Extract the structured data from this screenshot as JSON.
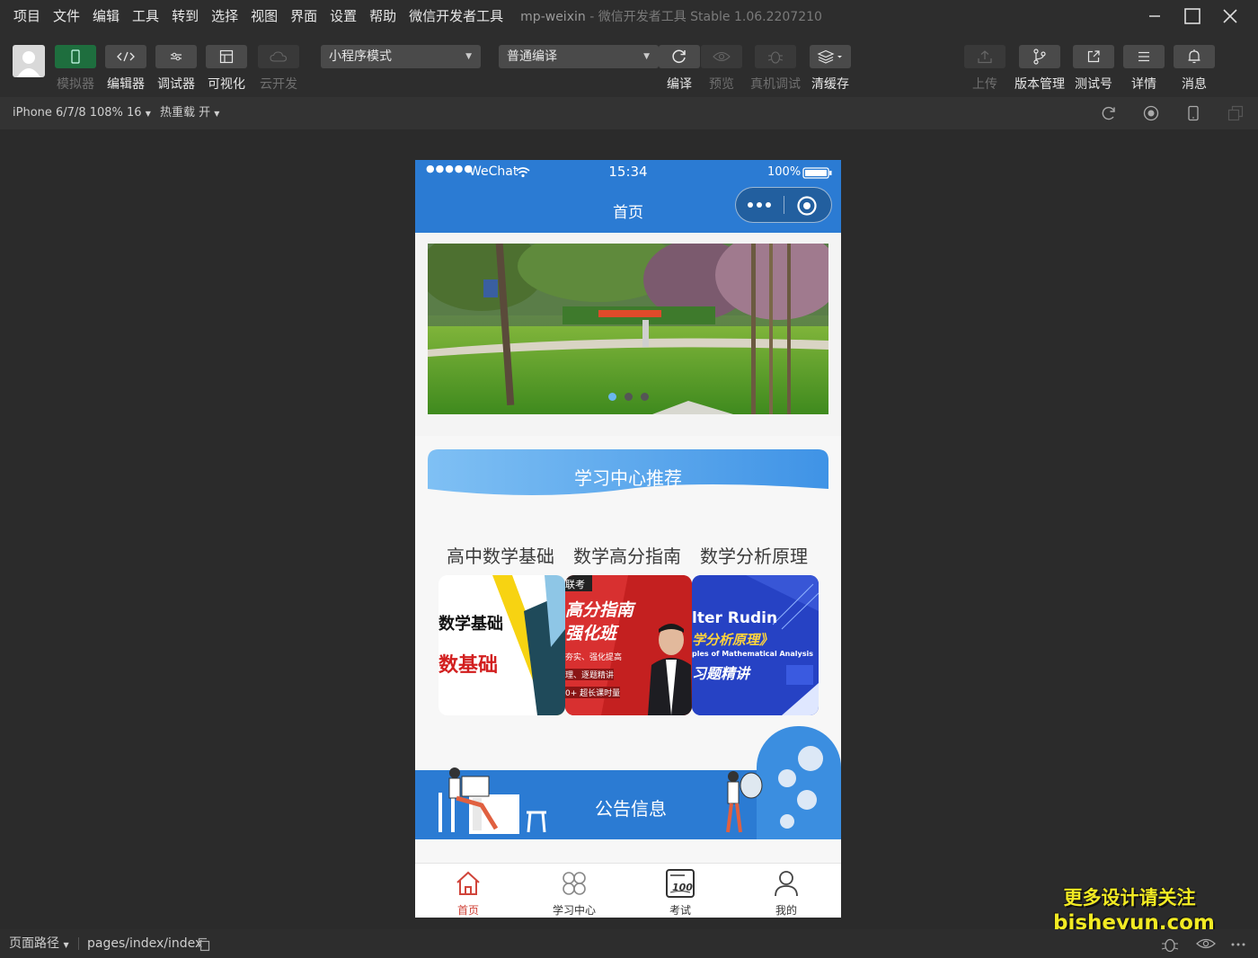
{
  "menubar": {
    "items": [
      "项目",
      "文件",
      "编辑",
      "工具",
      "转到",
      "选择",
      "视图",
      "界面",
      "设置",
      "帮助",
      "微信开发者工具"
    ],
    "project": "mp-weixin",
    "sep": "-",
    "app": "微信开发者工具 Stable 1.06.2207210"
  },
  "toolbar": {
    "simulator": "模拟器",
    "editor": "编辑器",
    "debugger": "调试器",
    "visual": "可视化",
    "cloud": "云开发",
    "mode": "小程序模式",
    "compile_mode": "普通编译",
    "compile": "编译",
    "preview": "预览",
    "remote_debug": "真机调试",
    "clear_cache": "清缓存",
    "upload": "上传",
    "version": "版本管理",
    "test_account": "测试号",
    "details": "详情",
    "messages": "消息"
  },
  "subbar": {
    "device": "iPhone 6/7/8 108% 16",
    "hot_reload": "热重载 开"
  },
  "phone": {
    "status": {
      "carrier": "WeChat",
      "time": "15:34",
      "battery": "100%"
    },
    "nav_title": "首页",
    "section_title": "学习中心推荐",
    "courses": [
      {
        "title": "高中数学基础",
        "cover_text": [
          "数学基础",
          "数基础"
        ]
      },
      {
        "title": "数学高分指南",
        "cover_text": [
          "联考",
          "高分指南",
          "强化班",
          "夯实、强化提高",
          "理、逐题精讲",
          "0+ 超长课时量"
        ]
      },
      {
        "title": "数学分析原理",
        "cover_text": [
          "lter Rudin",
          "学分析原理》",
          "ples of Mathematical Analysis",
          "习题精讲"
        ]
      }
    ],
    "notice_title": "公告信息",
    "tabs": [
      {
        "label": "首页",
        "icon": "home-icon",
        "active": true
      },
      {
        "label": "学习中心",
        "icon": "grid-icon",
        "active": false
      },
      {
        "label": "考试",
        "icon": "exam-icon",
        "active": false
      },
      {
        "label": "我的",
        "icon": "user-icon",
        "active": false
      }
    ],
    "accent": "#2b7bd3",
    "tab_active_color": "#d0443a"
  },
  "bottombar": {
    "path_label": "页面路径",
    "path": "pages/index/index"
  },
  "watermark": {
    "line1": "更多设计请关注",
    "line2": "bisheyun.com"
  }
}
